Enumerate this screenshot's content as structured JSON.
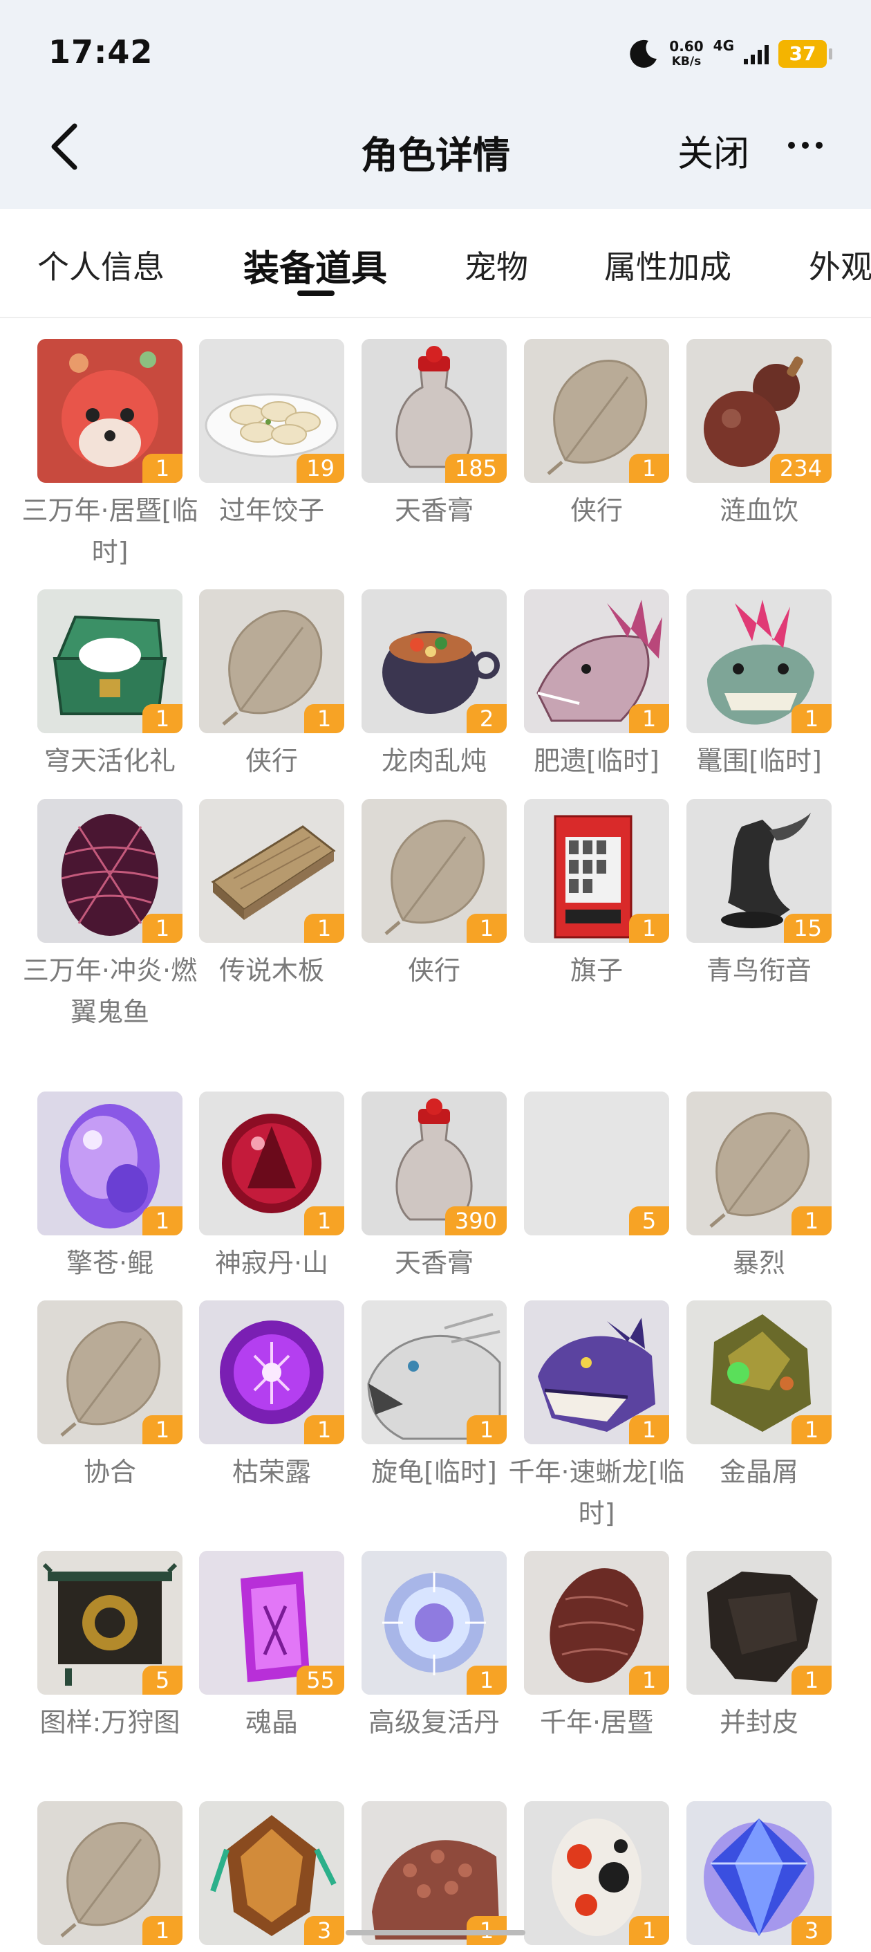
{
  "status_bar": {
    "time": "17:42",
    "net_speed": "0.60",
    "net_unit": "KB/s",
    "signal_type": "4G",
    "battery": "37"
  },
  "header": {
    "title": "角色详情",
    "close_label": "关闭"
  },
  "tabs": [
    {
      "label": "个人信息"
    },
    {
      "label": "装备道具"
    },
    {
      "label": "宠物"
    },
    {
      "label": "属性加成"
    },
    {
      "label": "外观"
    }
  ],
  "active_tab": "装备道具",
  "items": [
    {
      "name": "三万年·居暨[临时]",
      "count": "1",
      "icon": "red-fox-icon"
    },
    {
      "name": "过年饺子",
      "count": "19",
      "icon": "dumplings-icon"
    },
    {
      "name": "天香膏",
      "count": "185",
      "icon": "jar-icon"
    },
    {
      "name": "侠行",
      "count": "1",
      "icon": "leaf-icon"
    },
    {
      "name": "涟血饮",
      "count": "234",
      "icon": "gourd-icon"
    },
    {
      "name": "穹天活化礼",
      "count": "1",
      "icon": "treasure-chest-icon"
    },
    {
      "name": "侠行",
      "count": "1",
      "icon": "leaf-icon"
    },
    {
      "name": "龙肉乱炖",
      "count": "2",
      "icon": "stew-pot-icon"
    },
    {
      "name": "肥遗[临时]",
      "count": "1",
      "icon": "dragon-head-icon"
    },
    {
      "name": "鼍围[临时]",
      "count": "1",
      "icon": "beast-head-icon"
    },
    {
      "name": "三万年·冲炎·燃翼鬼鱼",
      "count": "1",
      "icon": "dragon-egg-icon"
    },
    {
      "name": "传说木板",
      "count": "1",
      "icon": "wood-plank-icon"
    },
    {
      "name": "侠行",
      "count": "1",
      "icon": "leaf-icon"
    },
    {
      "name": "旗子",
      "count": "1",
      "icon": "vending-machine-icon"
    },
    {
      "name": "青鸟衔音",
      "count": "15",
      "icon": "bird-whistle-icon"
    },
    {
      "name": "擎苍·鲲",
      "count": "1",
      "icon": "crystal-egg-icon"
    },
    {
      "name": "神寂丹·山",
      "count": "1",
      "icon": "red-orb-icon"
    },
    {
      "name": "天香膏",
      "count": "390",
      "icon": "jar-icon"
    },
    {
      "name": "",
      "count": "5",
      "icon": "empty-icon"
    },
    {
      "name": "暴烈",
      "count": "1",
      "icon": "leaf-icon"
    },
    {
      "name": "协合",
      "count": "1",
      "icon": "leaf-icon"
    },
    {
      "name": "枯荣露",
      "count": "1",
      "icon": "purple-orb-icon"
    },
    {
      "name": "旋龟[临时]",
      "count": "1",
      "icon": "white-beast-icon"
    },
    {
      "name": "千年·速蜥龙[临时]",
      "count": "1",
      "icon": "raptor-head-icon"
    },
    {
      "name": "金晶屑",
      "count": "1",
      "icon": "ore-chunk-icon"
    },
    {
      "name": "图样:万狩图",
      "count": "5",
      "icon": "scroll-banner-icon"
    },
    {
      "name": "魂晶",
      "count": "55",
      "icon": "soul-crystal-icon"
    },
    {
      "name": "高级复活丹",
      "count": "1",
      "icon": "glow-orb-icon"
    },
    {
      "name": "千年·居暨",
      "count": "1",
      "icon": "brown-egg-icon"
    },
    {
      "name": "并封皮",
      "count": "1",
      "icon": "hide-pelt-icon"
    },
    {
      "name": "",
      "count": "1",
      "icon": "leaf-icon"
    },
    {
      "name": "",
      "count": "3",
      "icon": "amber-gem-icon"
    },
    {
      "name": "",
      "count": "1",
      "icon": "dino-head-icon"
    },
    {
      "name": "",
      "count": "1",
      "icon": "spotted-egg-icon"
    },
    {
      "name": "",
      "count": "3",
      "icon": "blue-gem-icon"
    }
  ]
}
